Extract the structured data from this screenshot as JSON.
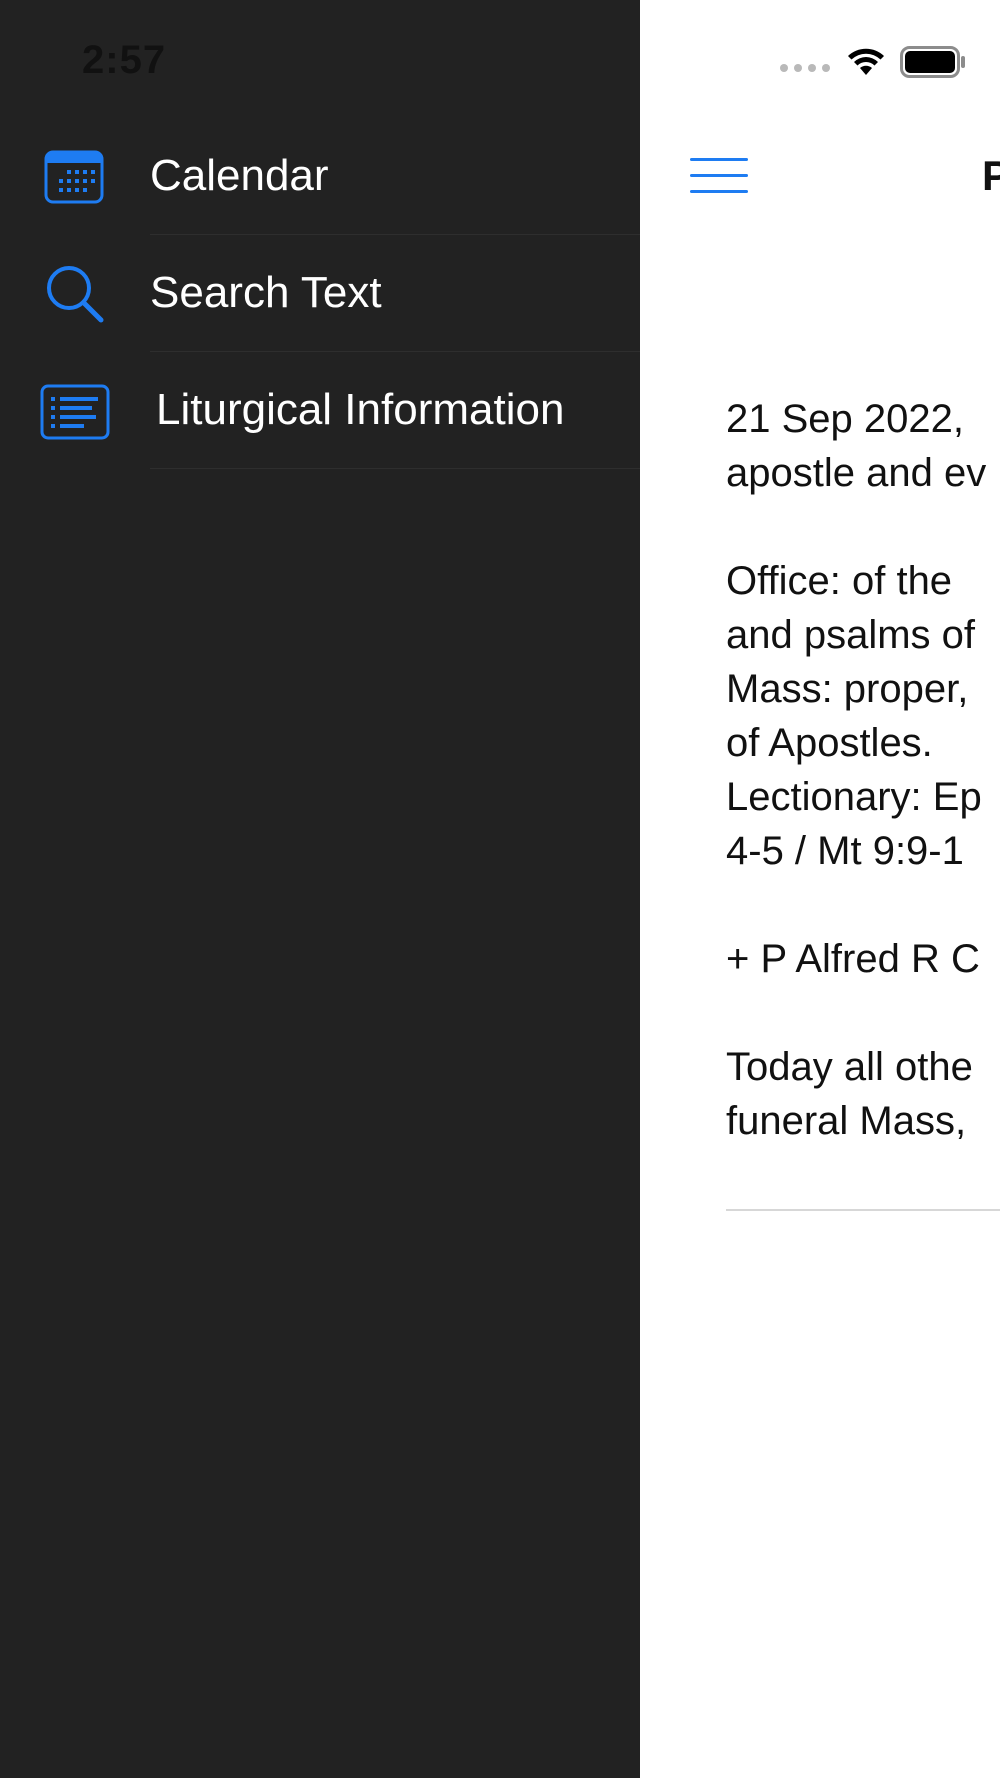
{
  "status_bar": {
    "time": "2:57"
  },
  "drawer": {
    "items": [
      {
        "label": "Calendar",
        "icon": "calendar-icon"
      },
      {
        "label": "Search Text",
        "icon": "search-icon"
      },
      {
        "label": "Liturgical Information",
        "icon": "list-icon"
      }
    ]
  },
  "nav": {
    "title": "P",
    "menu_icon": "hamburger-menu-icon"
  },
  "content": {
    "paragraphs": [
      [
        "21 Sep 2022,",
        "apostle and ev"
      ],
      [
        "Office: of the",
        "and psalms of",
        "Mass: proper,",
        "of Apostles.",
        "Lectionary: Ep",
        "4-5 / Mt 9:9-1"
      ],
      [
        "+ P Alfred R C"
      ],
      [
        "Today all othe",
        "funeral Mass,"
      ]
    ]
  },
  "colors": {
    "accent": "#1e7cf2",
    "drawer_background": "#222222",
    "content_background": "#ffffff"
  }
}
